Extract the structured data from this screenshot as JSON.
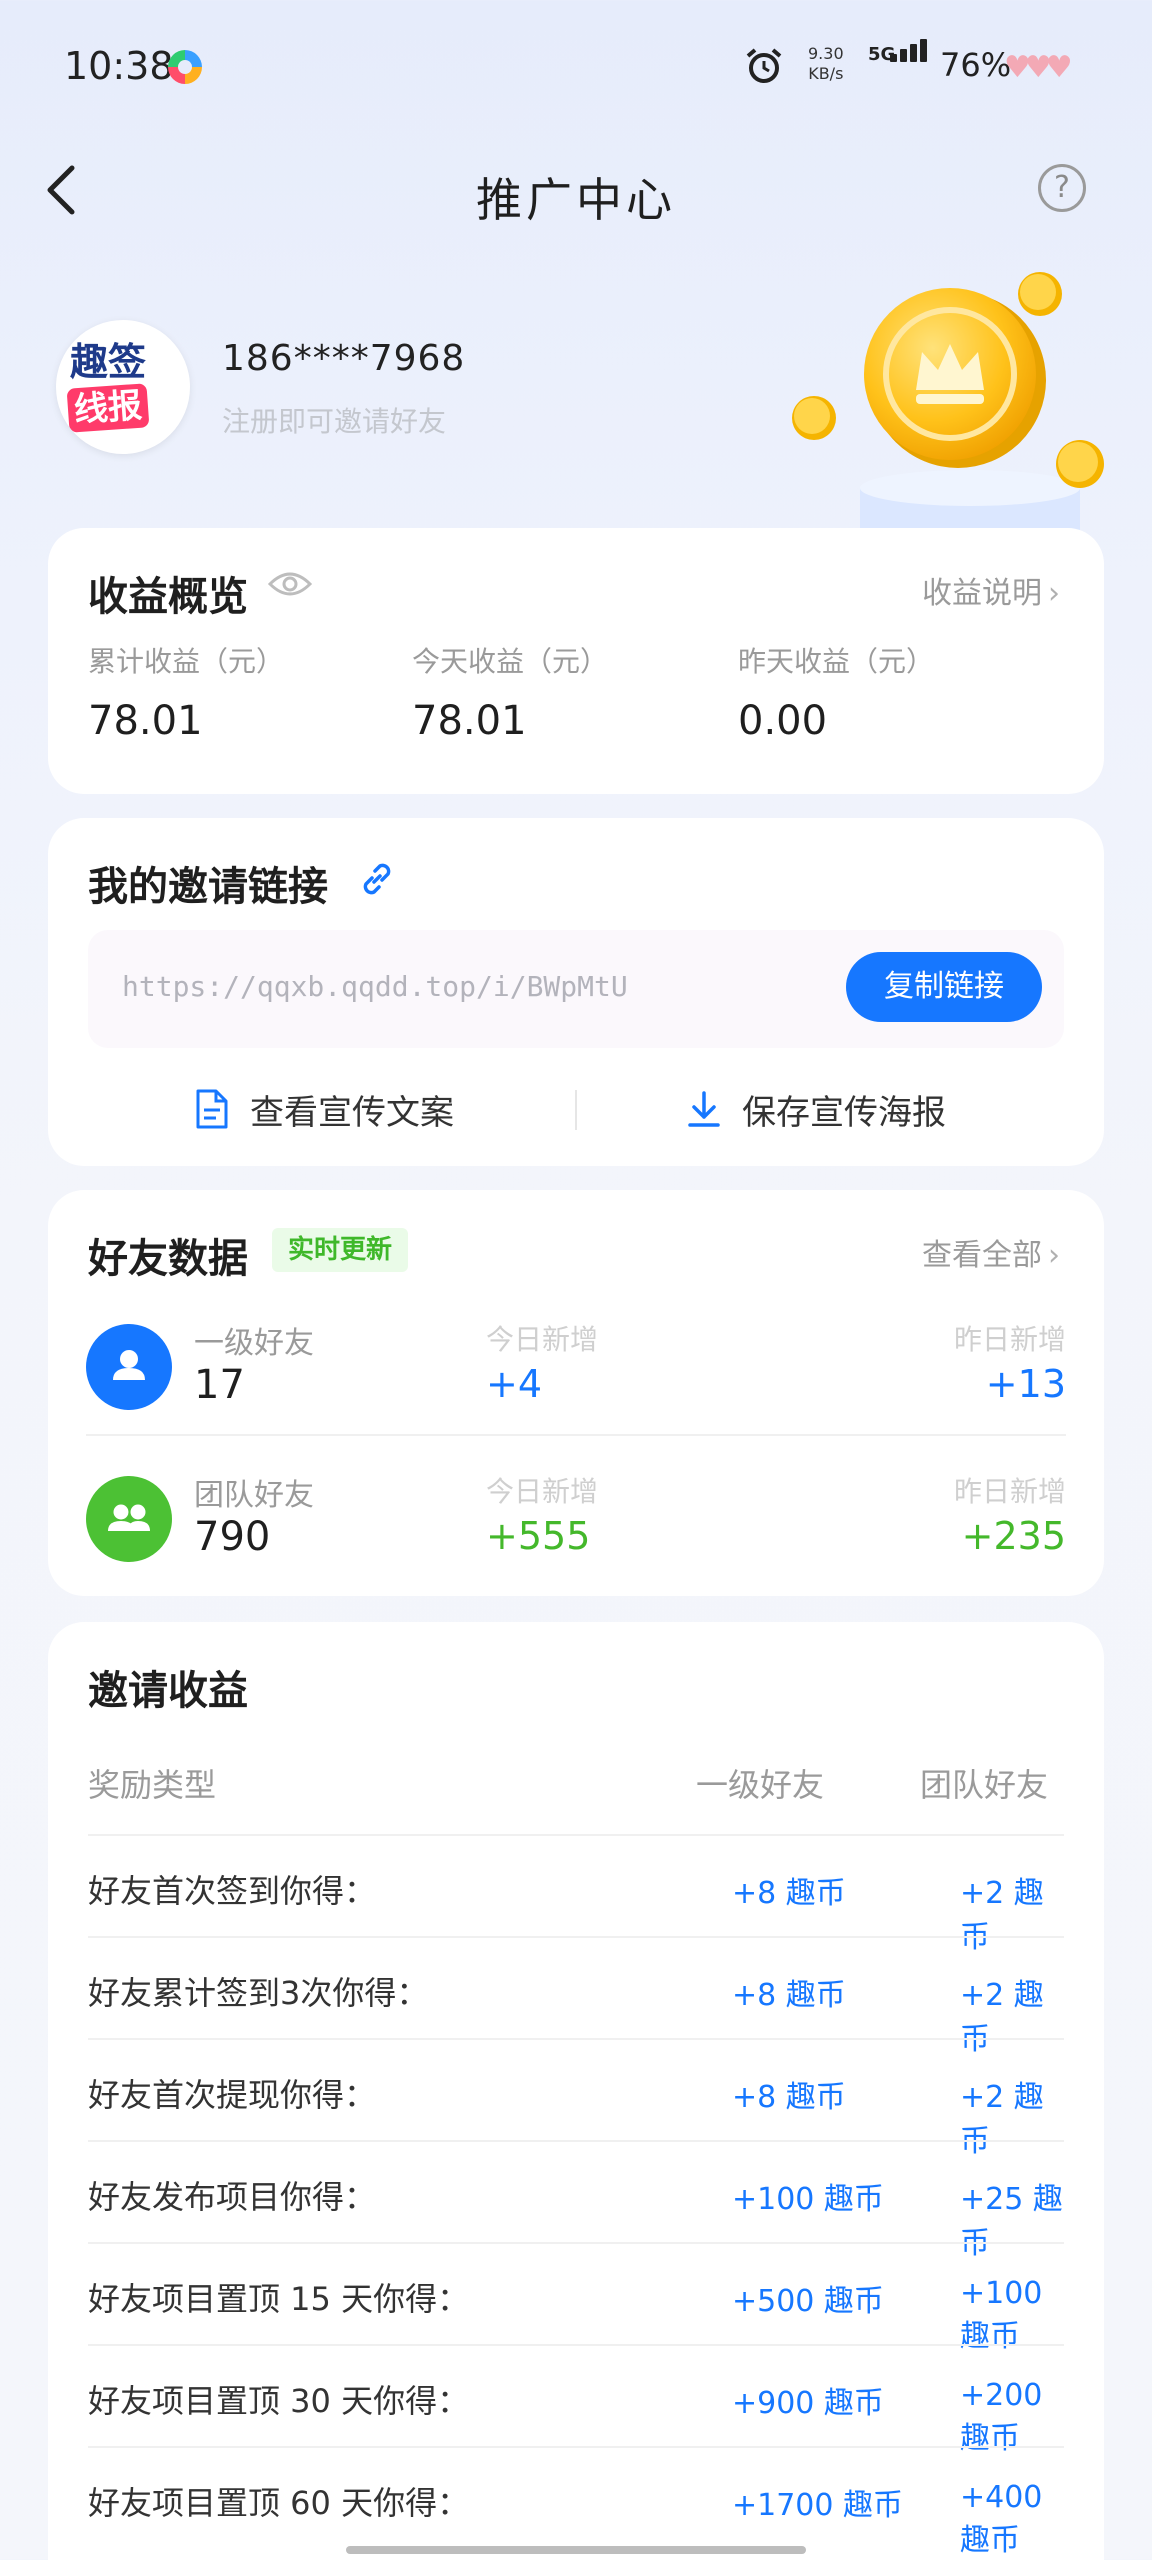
{
  "status_bar": {
    "time": "10:38",
    "speed_value": "9.30",
    "speed_unit": "KB/s",
    "network": "5G",
    "battery": "76%"
  },
  "nav": {
    "title": "推广中心",
    "help": "?"
  },
  "profile": {
    "avatar_line1": "趣签",
    "avatar_line2": "线报",
    "phone": "186****7968",
    "hint": "注册即可邀请好友"
  },
  "earnings": {
    "title": "收益概览",
    "link": "收益说明",
    "items": [
      {
        "label": "累计收益（元）",
        "value": "78.01"
      },
      {
        "label": "今天收益（元）",
        "value": "78.01"
      },
      {
        "label": "昨天收益（元）",
        "value": "0.00"
      }
    ]
  },
  "invite": {
    "title": "我的邀请链接",
    "url": "https://qqxb.qqdd.top/i/BWpMtU",
    "copy_label": "复制链接",
    "view_copy_label": "查看宣传文案",
    "save_poster_label": "保存宣传海报"
  },
  "friends": {
    "title": "好友数据",
    "badge": "实时更新",
    "link": "查看全部",
    "rows": [
      {
        "label": "一级好友",
        "count": "17",
        "today_label": "今日新增",
        "today": "+4",
        "yesterday_label": "昨日新增",
        "yesterday": "+13"
      },
      {
        "label": "团队好友",
        "count": "790",
        "today_label": "今日新增",
        "today": "+555",
        "yesterday_label": "昨日新增",
        "yesterday": "+235"
      }
    ]
  },
  "rewards": {
    "title": "邀请收益",
    "headers": [
      "奖励类型",
      "一级好友",
      "团队好友"
    ],
    "rows": [
      {
        "label": "好友首次签到你得：",
        "level1": "+8 趣币",
        "team": "+2 趣币"
      },
      {
        "label": "好友累计签到3次你得：",
        "level1": "+8 趣币",
        "team": "+2 趣币"
      },
      {
        "label": "好友首次提现你得：",
        "level1": "+8 趣币",
        "team": "+2 趣币"
      },
      {
        "label": "好友发布项目你得：",
        "level1": "+100 趣币",
        "team": "+25 趣币"
      },
      {
        "label": "好友项目置顶 15 天你得：",
        "level1": "+500 趣币",
        "team": "+100 趣币"
      },
      {
        "label": "好友项目置顶 30 天你得：",
        "level1": "+900 趣币",
        "team": "+200 趣币"
      },
      {
        "label": "好友项目置顶 60 天你得：",
        "level1": "+1700 趣币",
        "team": "+400 趣币"
      }
    ]
  },
  "colors": {
    "accent": "#1677ff",
    "green": "#44b82b"
  }
}
